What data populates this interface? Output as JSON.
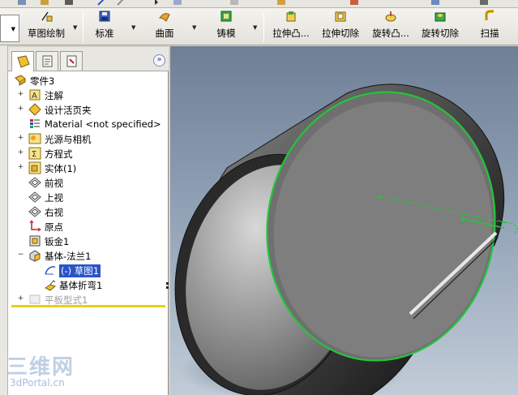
{
  "toolbar": {
    "buttons": [
      {
        "label": "草图绘制",
        "icon": "sketch-icon"
      },
      {
        "label": "标准",
        "icon": "standard-icon"
      },
      {
        "label": "曲面",
        "icon": "surface-icon"
      },
      {
        "label": "铸模",
        "icon": "mold-icon"
      },
      {
        "label": "拉伸凸...",
        "icon": "extruded-boss-icon"
      },
      {
        "label": "拉伸切除",
        "icon": "extruded-cut-icon"
      },
      {
        "label": "旋转凸...",
        "icon": "revolved-boss-icon"
      },
      {
        "label": "旋转切除",
        "icon": "revolved-cut-icon"
      },
      {
        "label": "扫描",
        "icon": "sweep-icon"
      }
    ]
  },
  "panel": {
    "tabs": [
      "feature-manager-tab",
      "property-manager-tab",
      "configuration-manager-tab"
    ],
    "collapse_label": "»"
  },
  "tree": {
    "root": "零件3",
    "items": [
      {
        "label": "注解",
        "icon": "annotations-icon",
        "expandable": true
      },
      {
        "label": "设计活页夹",
        "icon": "design-binder-icon",
        "expandable": true
      },
      {
        "label": "Material <not specified>",
        "icon": "material-icon",
        "expandable": false
      },
      {
        "label": "光源与相机",
        "icon": "lights-cameras-icon",
        "expandable": true
      },
      {
        "label": "方程式",
        "icon": "equations-icon",
        "expandable": true
      },
      {
        "label": "实体(1)",
        "icon": "solid-bodies-icon",
        "expandable": true
      },
      {
        "label": "前视",
        "icon": "plane-icon",
        "expandable": false
      },
      {
        "label": "上视",
        "icon": "plane-icon",
        "expandable": false
      },
      {
        "label": "右视",
        "icon": "plane-icon",
        "expandable": false
      },
      {
        "label": "原点",
        "icon": "origin-icon",
        "expandable": false
      },
      {
        "label": "钣金1",
        "icon": "sheet-metal-icon",
        "expandable": false
      },
      {
        "label": "基体-法兰1",
        "icon": "base-flange-icon",
        "expandable": true
      },
      {
        "label": "(-) 草图1",
        "icon": "sketch-icon",
        "expandable": false
      },
      {
        "label": "基体折弯1",
        "icon": "base-bend-icon",
        "expandable": false
      },
      {
        "label": "平板型式1",
        "icon": "flat-pattern-icon",
        "expandable": true
      }
    ]
  },
  "watermark": {
    "title": "三维网",
    "url": "3dPortal.cn"
  },
  "colors": {
    "selection": "#2a54c8",
    "sketch_green": "#22c63a",
    "rollback_bar": "#e6d20a"
  }
}
